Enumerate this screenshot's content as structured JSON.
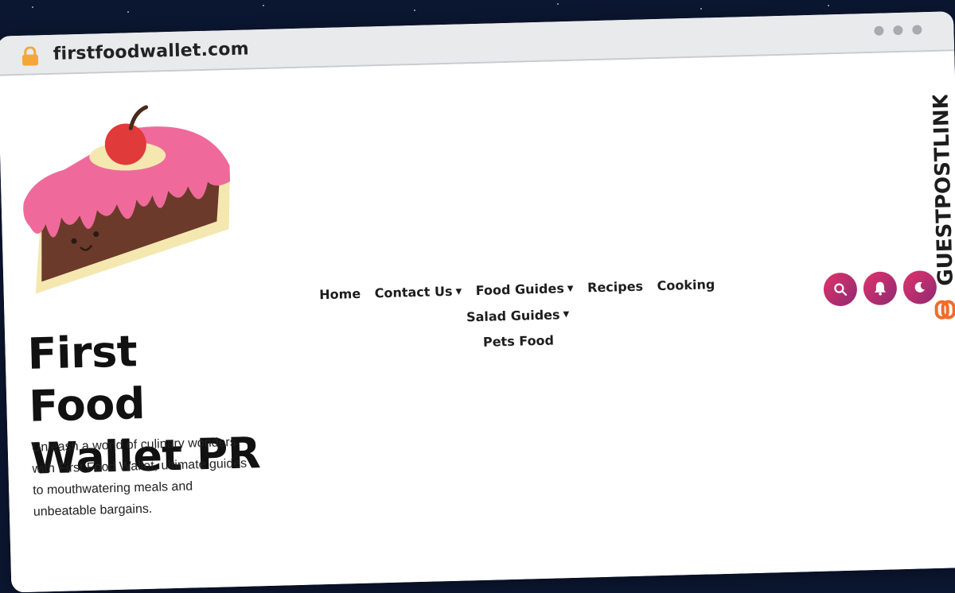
{
  "browser": {
    "url": "firstfoodwallet.com"
  },
  "site": {
    "title": "First Food Wallet PR",
    "tagline": "Unleash a world of culinary wonders with First Food Wallet, ultimate guides to mouthwatering meals and unbeatable bargains."
  },
  "nav": {
    "items": [
      {
        "label": "Home",
        "dropdown": false
      },
      {
        "label": "Contact Us",
        "dropdown": true
      },
      {
        "label": "Food Guides",
        "dropdown": true
      },
      {
        "label": "Recipes",
        "dropdown": false
      },
      {
        "label": "Cooking",
        "dropdown": false
      },
      {
        "label": "Salad Guides",
        "dropdown": true
      },
      {
        "label": "Pets Food",
        "dropdown": false
      }
    ]
  },
  "actions": {
    "icons": [
      "search-icon",
      "bell-icon",
      "moon-icon"
    ],
    "accent": "#d6336c"
  },
  "watermark": {
    "text": "GUESTPOSTLINKS"
  },
  "colors": {
    "background": "#0b1630",
    "cake_frosting": "#ef6a9b",
    "cake_chocolate": "#6b3a2a",
    "cake_cream": "#f4e8b0",
    "cherry": "#e03a3a",
    "lock": "#f3a73b",
    "watermark_orange": "#f26b2a"
  }
}
